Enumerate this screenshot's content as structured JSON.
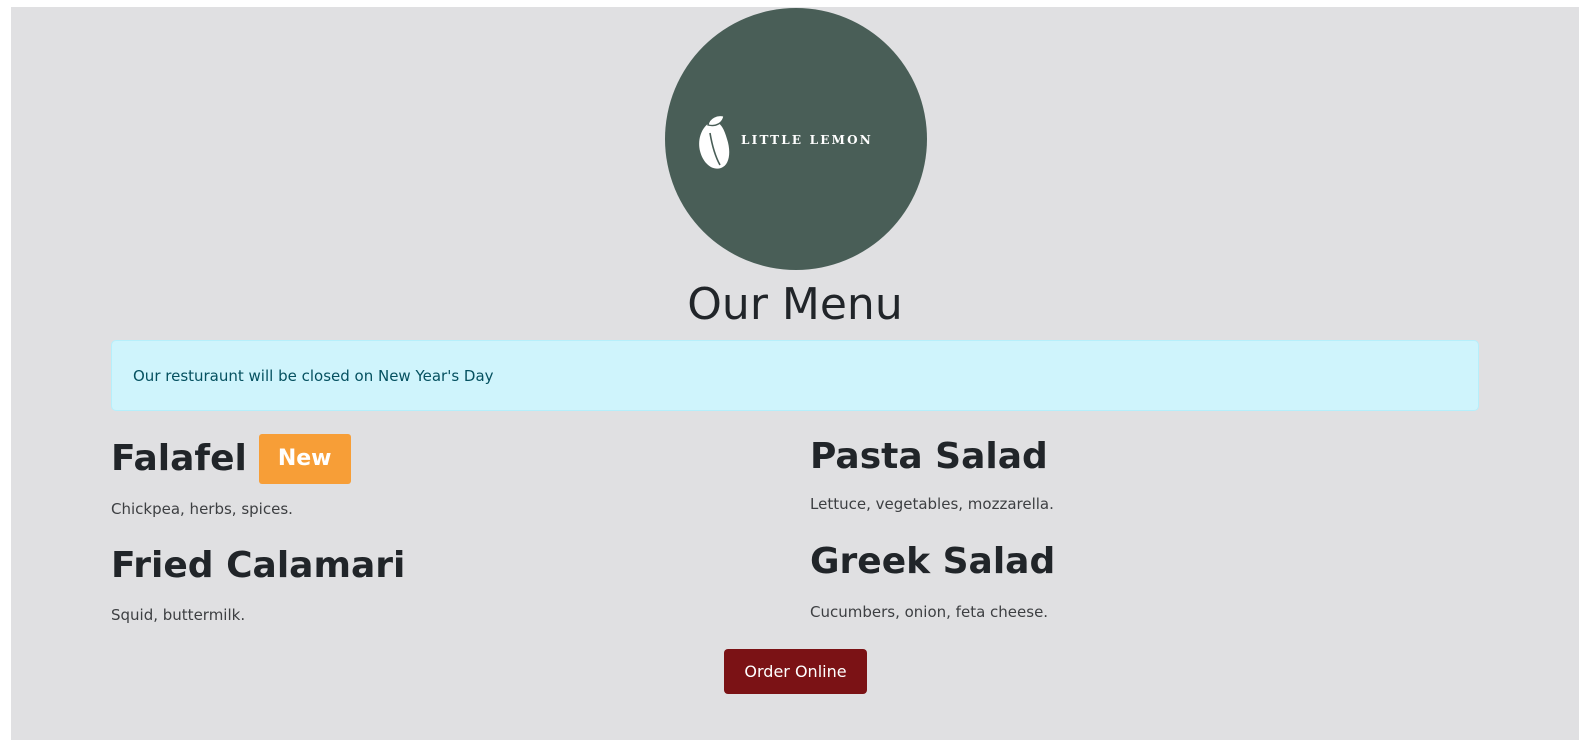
{
  "logo": {
    "brand_name": "LITTLE LEMON",
    "icon": "lemon-icon",
    "background_color": "#495e57"
  },
  "page_title": "Our Menu",
  "alert": {
    "message": "Our resturaunt will be closed on New Year's Day",
    "background_color": "#cff4fc"
  },
  "menu": {
    "items": [
      {
        "name": "Falafel",
        "badge": "New",
        "description": "Chickpea, herbs, spices."
      },
      {
        "name": "Pasta Salad",
        "description": "Lettuce, vegetables, mozzarella."
      },
      {
        "name": "Fried Calamari",
        "description": "Squid, buttermilk."
      },
      {
        "name": "Greek Salad",
        "description": "Cucumbers, onion, feta cheese."
      }
    ],
    "badge_color": "#f79e37"
  },
  "order_button": {
    "label": "Order Online",
    "color": "#7b1215"
  }
}
